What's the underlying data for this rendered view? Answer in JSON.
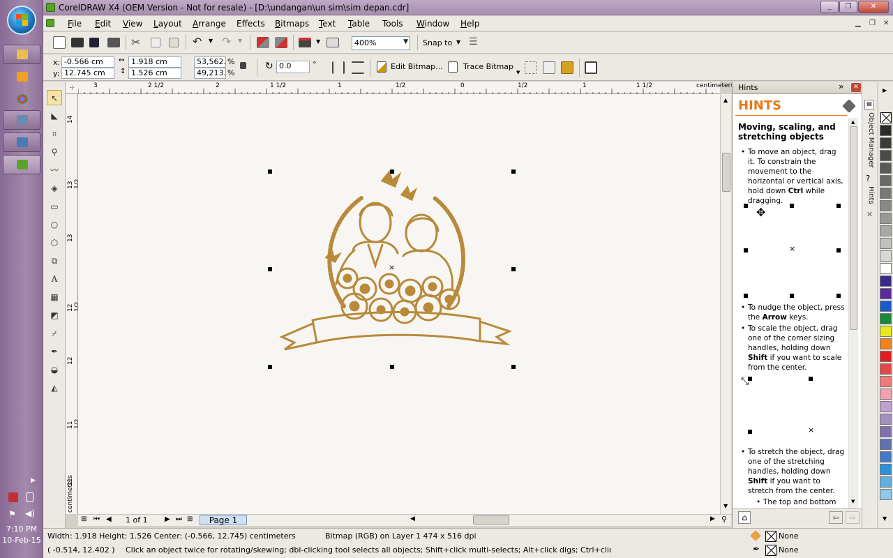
{
  "window": {
    "title": "CorelDRAW X4 (OEM Version - Not for resale) - [D:\\undangan\\un sim\\sim depan.cdr]",
    "controls": {
      "minimize": "_",
      "restore": "❐",
      "close": "✕"
    }
  },
  "menu": [
    {
      "label": "File",
      "key": "F",
      "rest": "ile"
    },
    {
      "label": "Edit",
      "key": "E",
      "rest": "dit"
    },
    {
      "label": "View",
      "key": "V",
      "rest": "iew"
    },
    {
      "label": "Layout",
      "key": "L",
      "rest": "ayout"
    },
    {
      "label": "Arrange",
      "key": "A",
      "rest": "rrange"
    },
    {
      "label": "Effects",
      "key": "C",
      "rest": "Effects"
    },
    {
      "label": "Bitmaps",
      "key": "B",
      "rest": "itmaps"
    },
    {
      "label": "Text",
      "key": "T",
      "rest": "ext"
    },
    {
      "label": "Table",
      "key": "T",
      "rest": "able"
    },
    {
      "label": "Tools",
      "key": "o",
      "rest": "Tools"
    },
    {
      "label": "Window",
      "key": "W",
      "rest": "indow"
    },
    {
      "label": "Help",
      "key": "H",
      "rest": "elp"
    }
  ],
  "toolbar": {
    "zoom": "400%",
    "snap_to": "Snap to"
  },
  "property_bar": {
    "x_label": "x:",
    "x_value": "-0.566 cm",
    "y_label": "y:",
    "y_value": "12.745 cm",
    "width_value": "1.918 cm",
    "height_value": "1.526 cm",
    "scale_x": "53,562.",
    "scale_y": "49,213.",
    "percent": "%",
    "rotation": "0.0",
    "degree": "°",
    "edit_bitmap": "Edit Bitmap...",
    "trace_bitmap": "Trace Bitmap"
  },
  "rulers": {
    "units": "centimeters",
    "h_ticks": [
      "3",
      "2 1/2",
      "2",
      "1 1/2",
      "1",
      "1/2",
      "0",
      "1/2",
      "1",
      "1 1/2"
    ],
    "v_ticks": [
      "14",
      "13 1/2",
      "13",
      "12 1/2",
      "12",
      "11 1/2",
      "11"
    ]
  },
  "page_nav": {
    "count": "1 of 1",
    "tab": "Page 1"
  },
  "hints": {
    "header": "Hints",
    "title": "HINTS",
    "subtitle": "Moving, scaling, and stretching objects",
    "p1": "To move an object, drag it. To constrain the movement to the horizontal or vertical axis, hold down",
    "p1_key": "Ctrl",
    "p1_end": "while dragging.",
    "p2": "To nudge the object, press the",
    "p2_key": "Arrow",
    "p2_end": "keys.",
    "p3": "To scale the object, drag one of the corner sizing handles, holding down",
    "p3_key": "Shift",
    "p3_end": "if you want to scale from the center.",
    "p4": "To stretch the object, drag one of the stretching handles, holding down",
    "p4_key": "Shift",
    "p4_end": "if you want to stretch from the center.",
    "p5": "The top and bottom"
  },
  "side_tabs": {
    "object_manager": "Object Manager",
    "hints": "Hints"
  },
  "status": {
    "dimensions": "Width: 1.918  Height: 1.526  Center: (-0.566, 12.745)  centimeters",
    "object_info": "Bitmap (RGB) on Layer 1 474 x 516 dpi",
    "cursor": "( -0.514, 12.402 )",
    "message": "Click an object twice for rotating/skewing; dbl-clicking tool selects all objects; Shift+click multi-selects; Alt+click digs; Ctrl+click selects in a group",
    "fill": "None",
    "outline": "None"
  },
  "taskbar": {
    "time": "7:10 PM",
    "date": "10-Feb-15"
  },
  "palette_colors": [
    "#2b2b2b",
    "#3b3b3b",
    "#4a4a4a",
    "#595959",
    "#696969",
    "#787878",
    "#888888",
    "#989898",
    "#a8a8a8",
    "#c0c0c0",
    "#d8d8d8",
    "#ffffff",
    "#3a2a8a",
    "#5a2a9a",
    "#1a5ac8",
    "#1a8a3a",
    "#e8e820",
    "#f08020",
    "#e02020",
    "#e04a4a",
    "#f07a7a",
    "#f0a0b0",
    "#c0a0d0",
    "#a090c0",
    "#8070b0",
    "#6070b0",
    "#4a78c8",
    "#3090d8",
    "#60b0e0",
    "#90c8e8"
  ],
  "accent": {
    "hints_orange": "#e8781a",
    "selection_gold": "#b88a3a"
  }
}
